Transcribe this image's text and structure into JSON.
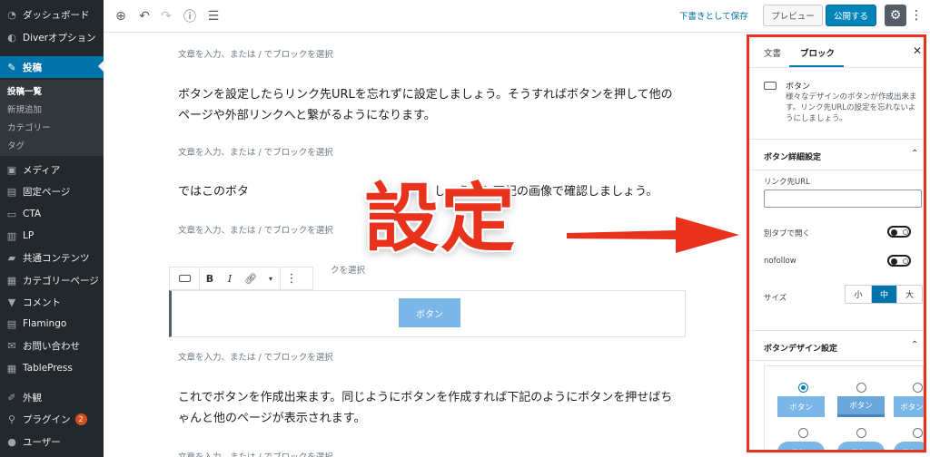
{
  "sidebar": {
    "items": [
      {
        "label": "ダッシュボード",
        "icon": "dashboard-icon"
      },
      {
        "label": "Diverオプション",
        "icon": "diver-icon"
      },
      {
        "label": "投稿",
        "icon": "pin-icon"
      },
      {
        "label": "メディア",
        "icon": "media-icon"
      },
      {
        "label": "固定ページ",
        "icon": "page-icon"
      },
      {
        "label": "CTA",
        "icon": "cta-icon"
      },
      {
        "label": "LP",
        "icon": "lp-icon"
      },
      {
        "label": "共通コンテンツ",
        "icon": "folder-icon"
      },
      {
        "label": "カテゴリーページ",
        "icon": "grid-icon"
      },
      {
        "label": "コメント",
        "icon": "comment-icon"
      },
      {
        "label": "Flamingo",
        "icon": "flamingo-icon"
      },
      {
        "label": "お問い合わせ",
        "icon": "mail-icon"
      },
      {
        "label": "TablePress",
        "icon": "table-icon"
      },
      {
        "label": "外観",
        "icon": "brush-icon"
      },
      {
        "label": "プラグイン",
        "icon": "plugin-icon",
        "badge": "2"
      },
      {
        "label": "ユーザー",
        "icon": "user-icon"
      }
    ],
    "submenu": [
      "投稿一覧",
      "新規追加",
      "カテゴリー",
      "タグ"
    ]
  },
  "toolbar": {
    "save_draft": "下書きとして保存",
    "preview": "プレビュー",
    "publish": "公開する"
  },
  "editor": {
    "placeholder": "文章を入力、または / でブロックを選択",
    "placeholder_partial": "クを選択",
    "para1": "ボタンを設定したらリンク先URLを忘れずに設定しましょう。そうすればボタンを押して他のページや外部リンクへと繋がるようになります。",
    "para2": "ではこのボタ",
    "para2b": "しょうか？下記の画像で確認しましょう。",
    "para3": "これでボタンを作成出来ます。同じようにボタンを作成すれば下記のようにボタンを押せばちゃんと他のページが表示されます。",
    "button_text": "ボタン",
    "format_bold": "B",
    "format_italic": "I"
  },
  "annotation": {
    "label": "設定",
    "color": "#e8321c"
  },
  "panel": {
    "tab_document": "文書",
    "tab_block": "ブロック",
    "block_name": "ボタン",
    "block_desc": "様々なデザインのボタンが作成出来ます。リンク先URLの設定を忘れないようにしましょう。",
    "section_detail": "ボタン詳細設定",
    "url_label": "リンク先URL",
    "url_value": "",
    "newtab_label": "別タブで開く",
    "nofollow_label": "nofollow",
    "size_label": "サイズ",
    "sizes": [
      "小",
      "中",
      "大"
    ],
    "selected_size": "中",
    "section_design": "ボタンデザイン設定",
    "design_button_label": "ボタン"
  }
}
